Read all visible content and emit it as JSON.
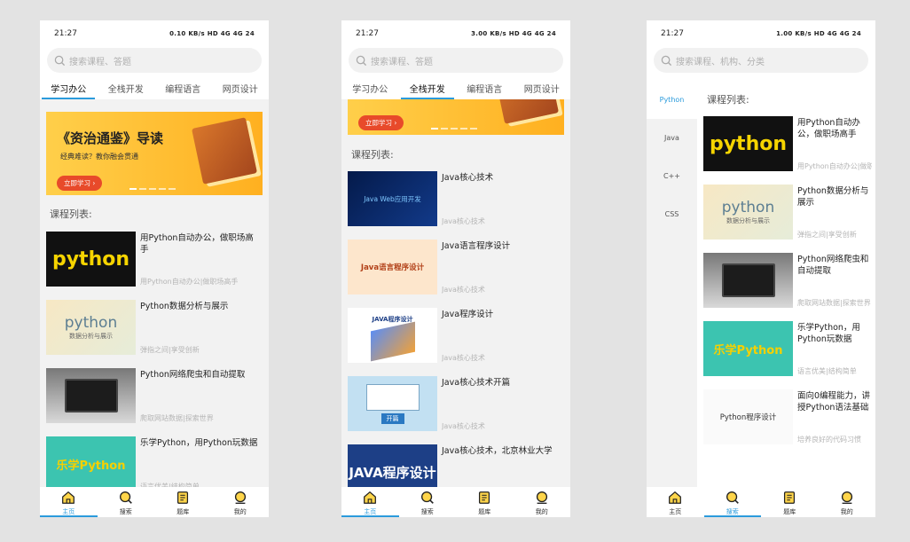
{
  "status": {
    "time": "21:27",
    "right1": "0.10 KB/s  HD  4G  4G  24",
    "right2": "3.00 KB/s  HD  4G  4G  24",
    "right3": "1.00 KB/s  HD  4G  4G  24"
  },
  "search": {
    "placeholder_main": "搜索课程、答题",
    "placeholder_category": "搜索课程、机构、分类"
  },
  "tabs": [
    "学习办公",
    "全栈开发",
    "编程语言",
    "网页设计"
  ],
  "banner": {
    "title": "《资治通鉴》导读",
    "subtitle": "经典难读？教你融会贯通",
    "button": "立即学习 ›"
  },
  "section_title": "课程列表:",
  "python_courses": [
    {
      "title": "用Python自动办公，做职场高手",
      "subtitle": "用Python自动办公|做职场高手",
      "thumb": "python"
    },
    {
      "title": "Python数据分析与展示",
      "subtitle": "弹指之间|享受创新",
      "thumb": "python",
      "thumb_sub": "数据分析与展示"
    },
    {
      "title": "Python网络爬虫和自动提取",
      "subtitle": "爬取网站数据|探索世界",
      "thumb": ""
    },
    {
      "title": "乐学Python，用Python玩数据",
      "subtitle": "语言优美|结构简单",
      "thumb": "乐学Python"
    },
    {
      "title": "面向0编程能力，讲授Python语法基础",
      "subtitle": "培养良好的代码习惯",
      "thumb": "Python程序设计"
    }
  ],
  "java_courses": [
    {
      "title": "Java核心技术",
      "subtitle": "Java核心技术",
      "thumb": "Java Web应用开发"
    },
    {
      "title": "Java语言程序设计",
      "subtitle": "Java核心技术",
      "thumb": "Java语言程序设计"
    },
    {
      "title": "Java程序设计",
      "subtitle": "Java核心技术",
      "thumb": "JAVA程序设计"
    },
    {
      "title": "Java核心技术开篇",
      "subtitle": "Java核心技术",
      "thumb": "开篇"
    },
    {
      "title": "Java核心技术，北京林业大学",
      "subtitle": "",
      "thumb": "JAVA程序设计"
    }
  ],
  "categories": [
    "Python",
    "Java",
    "C++",
    "CSS"
  ],
  "nav": [
    "主页",
    "搜索",
    "题库",
    "我的"
  ],
  "colors": {
    "accent": "#2b9bdc",
    "banner": "#ffbf30"
  }
}
